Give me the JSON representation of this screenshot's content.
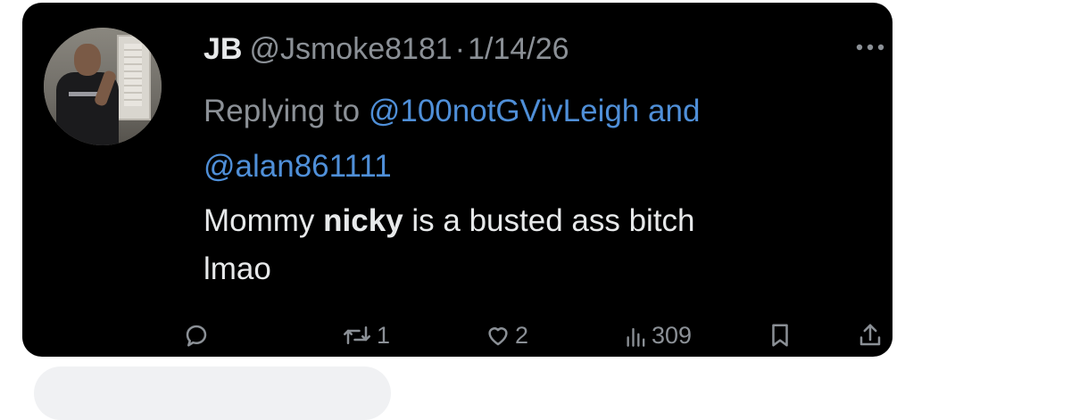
{
  "tweet": {
    "display_name": "JB",
    "handle": "@Jsmoke8181",
    "separator": "·",
    "date": "1/14/26",
    "replying_prefix": "Replying to",
    "reply_mention_1": "@100notGVivLeigh",
    "reply_and": "and",
    "reply_mention_2": "@alan861111",
    "text_part1": "Mommy",
    "text_bold": "nicky",
    "text_part2": "is a busted ass bitch",
    "text_part3": "lmao"
  },
  "actions": {
    "reply_icon": "reply-icon",
    "retweet_icon": "retweet-icon",
    "retweet_count": "1",
    "like_icon": "heart-icon",
    "like_count": "2",
    "views_icon": "analytics-icon",
    "views_count": "309",
    "bookmark_icon": "bookmark-icon",
    "share_icon": "share-icon"
  },
  "colors": {
    "card_background": "#000000",
    "primary_text": "#e7e9ea",
    "secondary_text": "#8b9096",
    "link": "#4f8fd8"
  }
}
